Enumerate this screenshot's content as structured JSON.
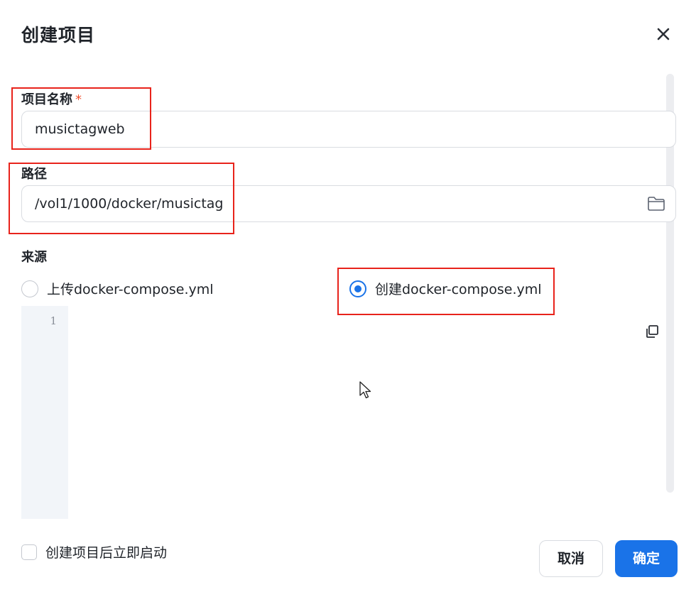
{
  "dialog": {
    "title": "创建项目"
  },
  "fields": {
    "project_name": {
      "label": "项目名称",
      "required_mark": "*",
      "value": "musictagweb"
    },
    "path": {
      "label": "路径",
      "value": "/vol1/1000/docker/musictag"
    },
    "source": {
      "label": "来源",
      "options": [
        {
          "label": "上传docker-compose.yml",
          "selected": false
        },
        {
          "label": "创建docker-compose.yml",
          "selected": true
        }
      ]
    }
  },
  "editor": {
    "line_numbers": [
      "1"
    ],
    "content": ""
  },
  "footer": {
    "autostart_label": "创建项目后立即启动",
    "autostart_checked": false,
    "cancel_label": "取消",
    "confirm_label": "确定"
  },
  "colors": {
    "primary": "#1a73e8",
    "annotation": "#e8231b",
    "required": "#f0502f"
  },
  "icons": [
    "close-icon",
    "folder-icon",
    "copy-icon",
    "mouse-cursor-icon"
  ]
}
